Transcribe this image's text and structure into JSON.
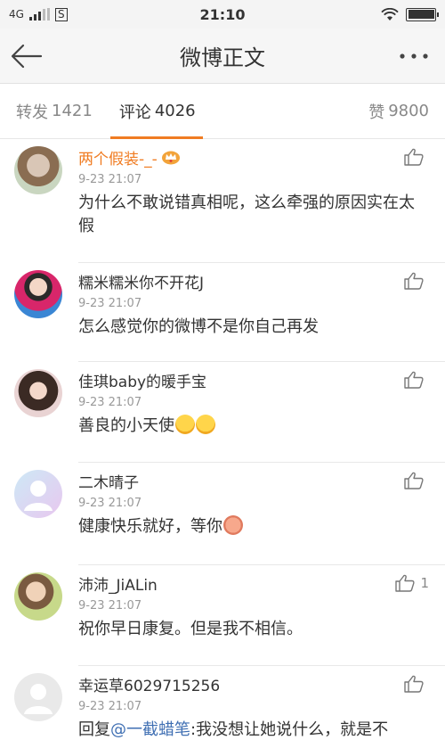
{
  "status_bar": {
    "network": "4G",
    "sim": "S",
    "time": "21:10"
  },
  "nav": {
    "title": "微博正文"
  },
  "tabs": {
    "repost": {
      "label": "转发",
      "count": "1421"
    },
    "comment": {
      "label": "评论",
      "count": "4026"
    },
    "like": {
      "label": "赞",
      "count": "9800"
    }
  },
  "comments": [
    {
      "name": "两个假装-_-",
      "time": "9-23 21:07",
      "text": "为什么不敢说错真相呢，这么牵强的原因实在太假",
      "likes": ""
    },
    {
      "name": "糯米糯米你不开花J",
      "time": "9-23 21:07",
      "text": "怎么感觉你的微博不是你自己再发",
      "likes": ""
    },
    {
      "name": "佳琪baby的暖手宝",
      "time": "9-23 21:07",
      "text": "善良的小天使",
      "likes": ""
    },
    {
      "name": "二木晴子",
      "time": "9-23 21:07",
      "text": "健康快乐就好，等你",
      "likes": ""
    },
    {
      "name": "沛沛_JiALin",
      "time": "9-23 21:07",
      "text": "祝你早日康复。但是我不相信。",
      "likes": "1"
    },
    {
      "name": "幸运草6029715256",
      "time": "9-23 21:07",
      "text_prefix": "回复",
      "mention": "@一截蜡笔",
      "text_suffix": ":我没想让她说什么，就是不",
      "likes": ""
    }
  ],
  "icons": {
    "back": "arrow-left-icon",
    "more": "more-dots-icon",
    "like": "thumbs-up-icon",
    "vip": "crown-badge-icon"
  },
  "colors": {
    "accent": "#f07c22",
    "mention": "#3f6fb3",
    "name_highlight": "#f07c22"
  }
}
